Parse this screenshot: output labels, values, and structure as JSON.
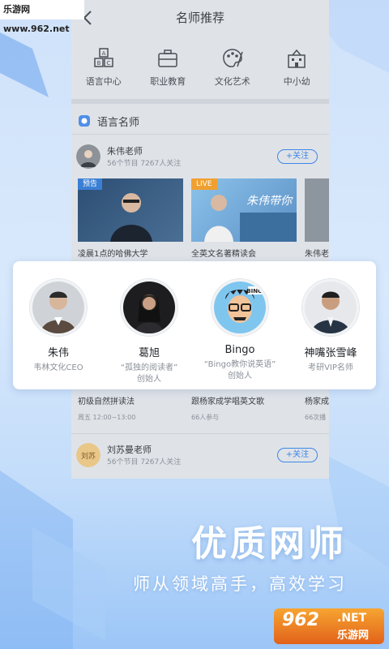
{
  "watermark": "乐游网 www.962.net",
  "nav": {
    "title": "名师推荐"
  },
  "categories": [
    {
      "label": "语言中心",
      "icon": "abc-blocks-icon"
    },
    {
      "label": "职业教育",
      "icon": "briefcase-icon"
    },
    {
      "label": "文化艺术",
      "icon": "palette-icon"
    },
    {
      "label": "中小幼",
      "icon": "school-icon"
    }
  ],
  "section": {
    "title": "语言名师",
    "icon": "section-badge-icon"
  },
  "teacher1": {
    "name": "朱伟老师",
    "meta": "56个节目  7267人关注",
    "follow": "+关注"
  },
  "courses": [
    {
      "title": "凌晨1点的哈佛大学",
      "tag": "预告",
      "tag_color": "#3a7fd4"
    },
    {
      "title": "全英文名著精读会",
      "tag": "LIVE",
      "tag_color": "#f0a030"
    },
    {
      "title": "朱伟老",
      "tag": "",
      "tag_color": ""
    }
  ],
  "experts": [
    {
      "name": "朱伟",
      "desc": "韦林文化CEO",
      "desc2": ""
    },
    {
      "name": "葛旭",
      "desc": "“孤独的阅读者”",
      "desc2": "创始人"
    },
    {
      "name": "Bingo",
      "desc": "“Bingo教你说英语”",
      "desc2": "创始人"
    },
    {
      "name": "神嘴张雪峰",
      "desc": "考研VIP名师",
      "desc2": ""
    }
  ],
  "row2": [
    {
      "title": "初级自然拼读法",
      "meta": "周五 12:00~13:00"
    },
    {
      "title": "跟杨家成学唱英文歌",
      "meta": "66人参与"
    },
    {
      "title": "杨家成",
      "meta": "66次播"
    }
  ],
  "teacher2": {
    "name": "刘苏曼老师",
    "meta": "56个节目  7267人关注",
    "follow": "+关注"
  },
  "slogan": "优质网师",
  "subslogan": "师从领域高手，高效学习",
  "logo": {
    "big": "962",
    "net": ".NET",
    "small": "乐游网"
  },
  "colors": {
    "accent": "#3f86e6",
    "tag_live": "#f0a030",
    "tag_preview": "#3a7fd4"
  }
}
